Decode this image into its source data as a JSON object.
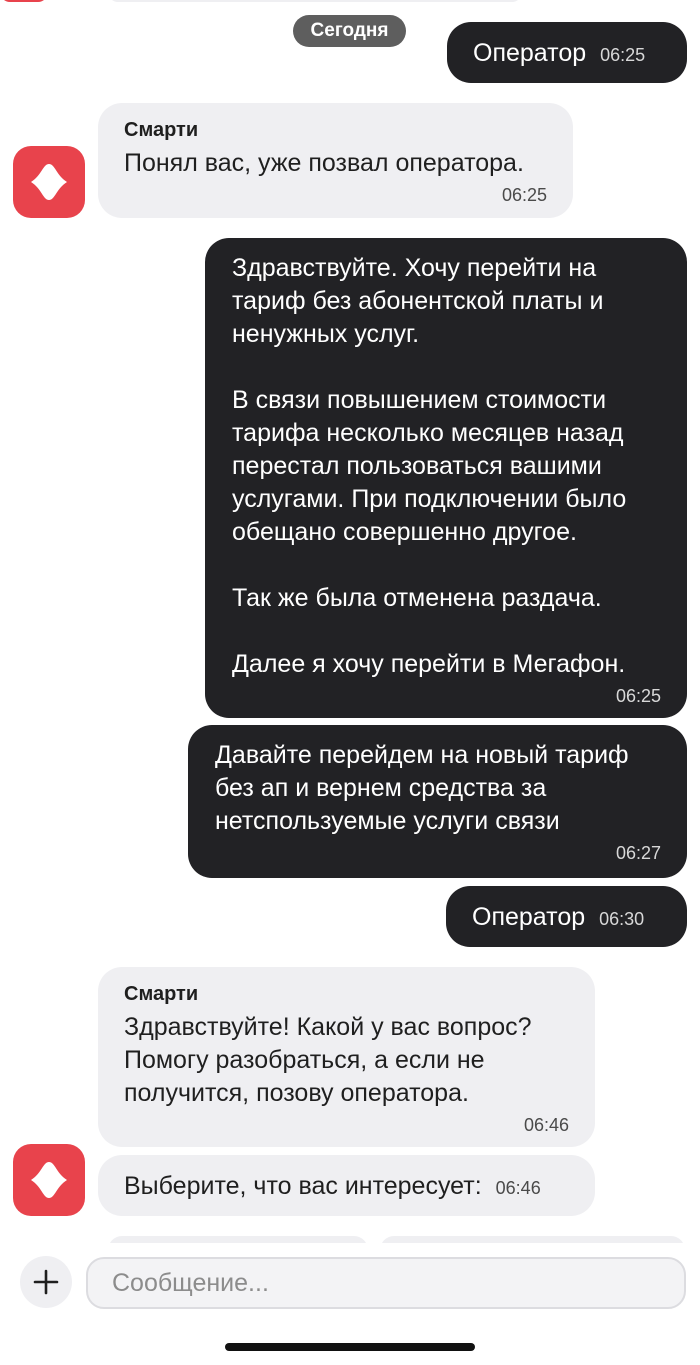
{
  "date_divider": "Сегодня",
  "messages": [
    {
      "direction": "outgoing",
      "text": "Оператор",
      "time": "06:25"
    },
    {
      "direction": "incoming",
      "sender": "Смарти",
      "text": "Понял вас, уже позвал оператора.",
      "time": "06:25"
    },
    {
      "direction": "outgoing",
      "text": "Здравствуйте. Хочу перейти на\nтариф без абонентской платы и\nненужных услуг.\n\nВ связи повышением стоимости\nтарифа несколько месяцев назад\nперестал пользоваться вашими\nуслугами. При подключении было\nобещано совершенно другое.\n\nТак же была отменена раздача.\n\nДалее я хочу перейти в Мегафон.",
      "time": "06:25"
    },
    {
      "direction": "outgoing",
      "text": "Давайте перейдем на новый тариф\nбез ап и вернем средства за\nнетспользуемые услуги связи",
      "time": "06:27"
    },
    {
      "direction": "outgoing",
      "text": "Оператор",
      "time": "06:30"
    },
    {
      "direction": "incoming",
      "sender": "Смарти",
      "text": "Здравствуйте! Какой у вас вопрос?\nПомогу разобраться, а если не\nполучится, позову оператора.",
      "time": "06:46"
    },
    {
      "direction": "incoming",
      "text": "Выберите, что вас интересует:",
      "time": "06:46"
    }
  ],
  "composer": {
    "placeholder": "Сообщение...",
    "value": ""
  },
  "icons": {
    "bot_avatar": "smarty-logo-icon",
    "attach": "plus-icon"
  },
  "colors": {
    "outgoing_bubble": "#222225",
    "incoming_bubble": "#efeff2",
    "brand": "#e8434c"
  }
}
